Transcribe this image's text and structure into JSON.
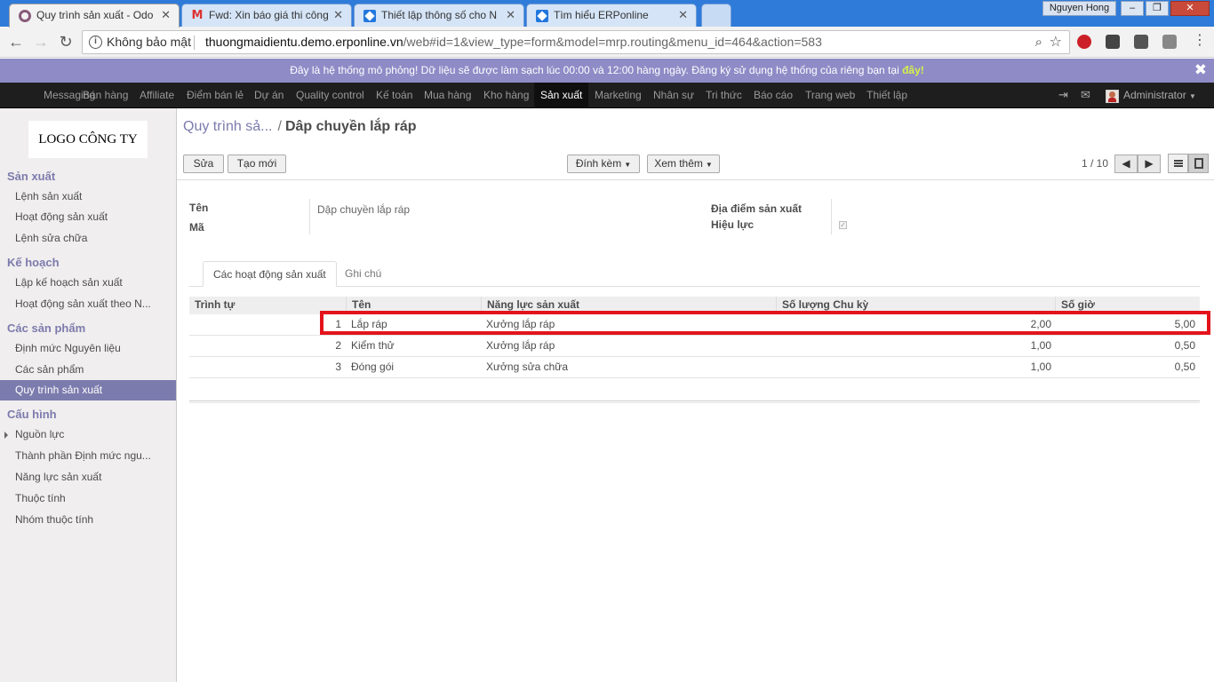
{
  "browser": {
    "tabs": [
      {
        "title": "Quy trình sản xuất - Odo",
        "icon": "odoo-icon",
        "active": true
      },
      {
        "title": "Fwd: Xin báo giá thi công",
        "icon": "gmail-icon",
        "active": false
      },
      {
        "title": "Thiết lập thông số cho N",
        "icon": "erponline-icon",
        "active": false
      },
      {
        "title": "Tìm hiểu ERPonline",
        "icon": "erponline-icon",
        "active": false
      }
    ],
    "close_glyph": "✕",
    "user_chip": "Nguyen Hong",
    "window_buttons": {
      "minimize": "–",
      "maximize": "❐",
      "close": "✕"
    },
    "nav": {
      "back": "←",
      "forward": "→",
      "reload": "↻"
    },
    "security_label": "Không bảo mật",
    "url_host": "thuongmaidientu.demo.erponline.vn",
    "url_path": "/web#id=1&view_type=form&model=mrp.routing&menu_id=464&action=583"
  },
  "banner": {
    "text": "Đây là hệ thống mô phỏng! Dữ liệu sẽ được làm sạch lúc 00:00 và 12:00 hàng ngày. Đăng ký sử dụng hệ thống của riêng bạn tại ",
    "link": "đây!",
    "close": "✖"
  },
  "topmenu": {
    "items": [
      "Messaging",
      "Bán hàng",
      "Affiliate",
      "Điểm bán lẻ",
      "Dự án",
      "Quality control",
      "Kế toán",
      "Mua hàng",
      "Kho hàng",
      "Sản xuất",
      "Marketing",
      "Nhân sự",
      "Tri thức",
      "Báo cáo",
      "Trang web",
      "Thiết lập"
    ],
    "active_index": 9,
    "user": "Administrator"
  },
  "sidebar": {
    "logo": "LOGO CÔNG TY",
    "sections": [
      {
        "title": "Sản xuất",
        "items": [
          "Lệnh sản xuất",
          "Hoạt động sản xuất",
          "Lệnh sửa chữa"
        ]
      },
      {
        "title": "Kế hoạch",
        "items": [
          "Lập kế hoạch sản xuất",
          "Hoạt động sản xuất theo N..."
        ]
      },
      {
        "title": "Các sản phẩm",
        "items": [
          "Định mức Nguyên liệu",
          "Các sản phẩm",
          "Quy trình sản xuất"
        ]
      },
      {
        "title": "Cấu hình",
        "items": [
          "Nguồn lực",
          "Thành phần Định mức ngu...",
          "Năng lực sản xuất",
          "Thuộc tính",
          "Nhóm thuộc tính"
        ]
      }
    ],
    "active_item": "Quy trình sản xuất"
  },
  "control_panel": {
    "breadcrumb_parent": "Quy trình sả...",
    "breadcrumb_separator": "/",
    "breadcrumb_current": "Dâp chuyền lắp ráp",
    "buttons": {
      "edit": "Sửa",
      "create": "Tạo mới",
      "attach": "Đính kèm",
      "more": "Xem thêm"
    },
    "pager": "1 / 10"
  },
  "form": {
    "labels": {
      "name": "Tên",
      "code": "Mã",
      "location": "Địa điểm sản xuất",
      "active": "Hiệu lực"
    },
    "name_value": "Dập chuyền lắp ráp",
    "active_checked": true,
    "tabs": [
      "Các hoạt động sản xuất",
      "Ghi chú"
    ],
    "table": {
      "headers": [
        "Trình tự",
        "Tên",
        "Năng lực sản xuất",
        "Số lượng Chu kỳ",
        "Số giờ"
      ],
      "rows": [
        {
          "seq": "1",
          "name": "Lắp ráp",
          "workcenter": "Xưởng lắp ráp",
          "cycles": "2,00",
          "hours": "5,00"
        },
        {
          "seq": "2",
          "name": "Kiểm thử",
          "workcenter": "Xưởng lắp ráp",
          "cycles": "1,00",
          "hours": "0,50"
        },
        {
          "seq": "3",
          "name": "Đóng gói",
          "workcenter": "Xưởng sửa chữa",
          "cycles": "1,00",
          "hours": "0,50"
        }
      ],
      "highlighted_row": 0,
      "highlight_color": "#e3131b"
    }
  }
}
